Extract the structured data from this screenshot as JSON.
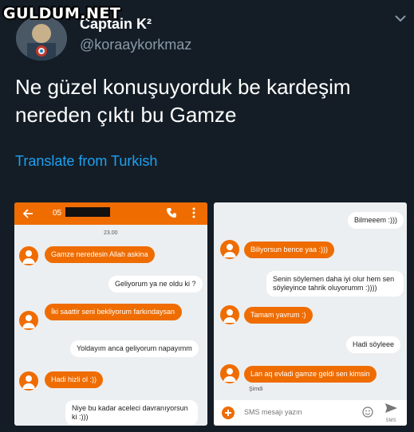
{
  "watermark": "GULDUM.NET",
  "tweet": {
    "display_name": "Captain K²",
    "handle": "@koraaykorkmaz",
    "text_line1": "Ne güzel konuşuyorduk be kardeşim",
    "text_line2": "nereden çıktı bu Gamze",
    "translate_label": "Translate from Turkish"
  },
  "left_chat": {
    "header_number": "05 ",
    "date": "23.00",
    "messages": [
      {
        "dir": "in",
        "text": "Gamze neredesin Allah askina"
      },
      {
        "dir": "out",
        "text": "Geliyorum ya ne oldu ki ?"
      },
      {
        "dir": "in",
        "text": "İki saattir seni bekliyorum farkındaysan"
      },
      {
        "dir": "out",
        "text": "Yoldayım anca geliyorum napayımm"
      },
      {
        "dir": "in",
        "text": "Hadi hizli ol :))"
      },
      {
        "dir": "out",
        "text": "Niye bu kadar aceleci davranıyorsun ki :)))"
      }
    ]
  },
  "right_chat": {
    "messages": [
      {
        "dir": "out",
        "text": "Bilmeeem :)))"
      },
      {
        "dir": "in",
        "text": "Biliyorsun bence yaa :)))"
      },
      {
        "dir": "out",
        "text": "Senin söylemen daha iyi olur hem sen söyleyince tahrik oluyorumm :))))"
      },
      {
        "dir": "in",
        "text": "Tamam yavrum :)"
      },
      {
        "dir": "out",
        "text": "Hadi söyleee"
      },
      {
        "dir": "in",
        "text": "Lan aq evladi gamze geldi sen kimsin"
      }
    ],
    "timestamp": "Şimdi",
    "composer_placeholder": "SMS mesajı yazın",
    "send_label": "SMS"
  }
}
